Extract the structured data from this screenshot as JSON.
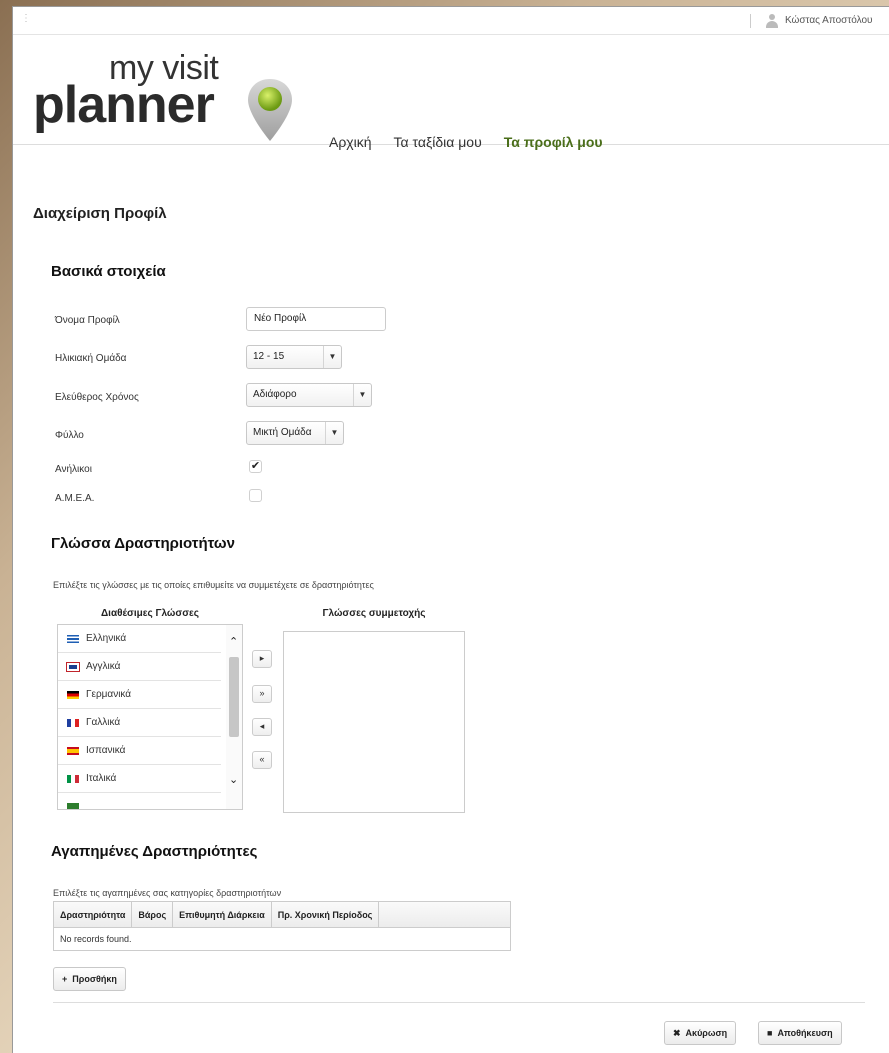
{
  "topbar": {
    "user_name": "Κώστας Αποστόλου"
  },
  "logo": {
    "line1": "my visit",
    "line2": "planner"
  },
  "nav": [
    {
      "label": "Αρχική"
    },
    {
      "label": "Τα ταξίδια μου"
    },
    {
      "label": "Τα προφίλ μου",
      "active": true
    }
  ],
  "page_title": "Διαχείριση Προφίλ",
  "basic": {
    "title": "Βασικά στοιχεία",
    "profile_name_label": "Όνομα Προφίλ",
    "profile_name_value": "Νέο Προφίλ",
    "age_group_label": "Ηλικιακή Ομάδα",
    "age_group_value": "12 - 15",
    "free_time_label": "Ελεύθερος Χρόνος",
    "free_time_value": "Αδιάφορο",
    "gender_label": "Φύλλο",
    "gender_value": "Μικτή Ομάδα",
    "adults_label": "Ανήλικοι",
    "adults_checked": true,
    "amea_label": "Α.Μ.Ε.Α.",
    "amea_checked": false
  },
  "languages": {
    "title": "Γλώσσα Δραστηριοτήτων",
    "helper": "Επιλέξτε τις γλώσσες με τις οποίες επιθυμείτε να συμμετέχετε σε δραστηριότητες",
    "available_header": "Διαθέσιμες Γλώσσες",
    "selected_header": "Γλώσσες συμμετοχής",
    "items": [
      {
        "label": "Ελληνικά",
        "flag": "greece"
      },
      {
        "label": "Αγγλικά",
        "flag": "uk"
      },
      {
        "label": "Γερμανικά",
        "flag": "germany"
      },
      {
        "label": "Γαλλικά",
        "flag": "france"
      },
      {
        "label": "Ισπανικά",
        "flag": "spain"
      },
      {
        "label": "Ιταλικά",
        "flag": "italy"
      }
    ],
    "move_buttons": [
      "▸",
      "»",
      "◂",
      "«"
    ]
  },
  "activities": {
    "title": "Αγαπημένες Δραστηριότητες",
    "helper": "Επιλέξτε τις αγαπημένες σας κατηγορίες δραστηριοτήτων",
    "columns": [
      "Δραστηριότητα",
      "Βάρος",
      "Επιθυμητή Διάρκεια",
      "Πρ. Χρονική Περίοδος"
    ],
    "empty": "No records found.",
    "add_label": "Προσθήκη"
  },
  "footer": {
    "cancel_label": "Ακύρωση",
    "save_label": "Αποθήκευση"
  }
}
